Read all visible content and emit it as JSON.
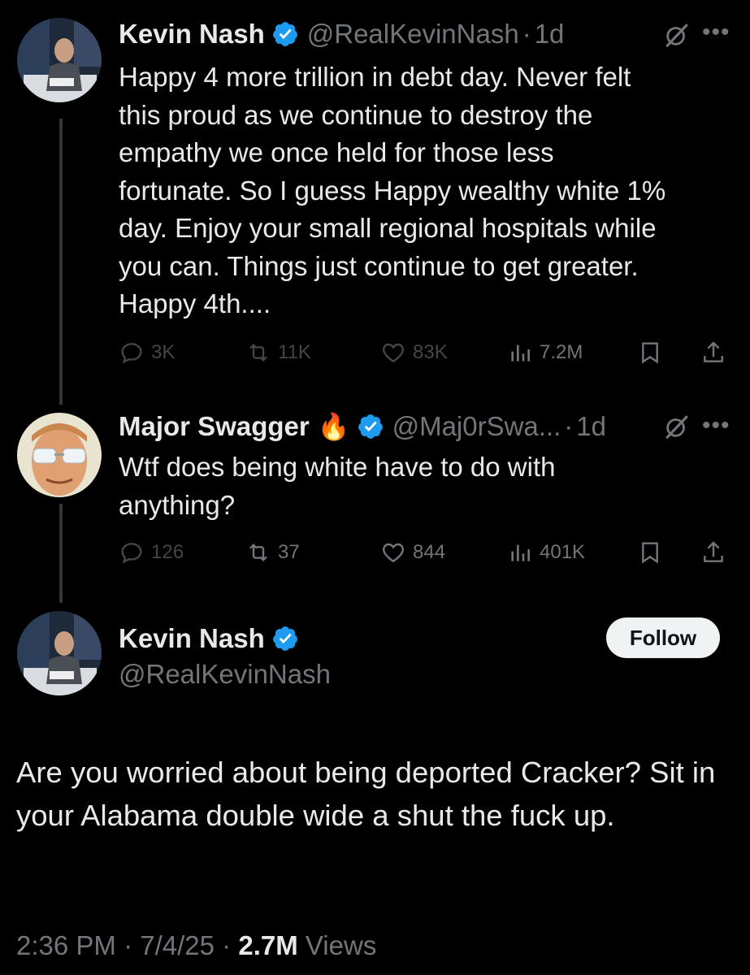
{
  "colors": {
    "background": "#000000",
    "text": "#e7e9ea",
    "muted": "#71767b",
    "verified_blue": "#1d9bf0",
    "follow_bg": "#eff3f4"
  },
  "tweet1": {
    "author_name": "Kevin Nash",
    "handle": "@RealKevinNash",
    "separator": "·",
    "time": "1d",
    "text": "Happy 4 more trillion in debt day. Never felt\nthis proud as we continue to destroy the\nempathy we once held for those less\nfortunate. So I guess Happy wealthy white 1%\nday. Enjoy your small regional hospitals while\nyou can. Things just continue to get greater.\nHappy 4th....",
    "replies": "3K",
    "reposts": "11K",
    "likes": "83K",
    "views": "7.2M"
  },
  "tweet2": {
    "author_name": "Major Swagger",
    "emoji": "🔥",
    "handle": "@Maj0rSwa...",
    "separator": "·",
    "time": "1d",
    "text": "Wtf does being white have to do with\nanything?",
    "replies": "126",
    "reposts": "37",
    "likes": "844",
    "views": "401K"
  },
  "main_tweet": {
    "author_name": "Kevin Nash",
    "handle": "@RealKevinNash",
    "follow_label": "Follow",
    "text": "Are you worried about being deported Cracker? Sit in your Alabama double wide a shut the fuck up.",
    "time": "2:36 PM",
    "sep1": "·",
    "date": "7/4/25",
    "sep2": "·",
    "views_count": "2.7M",
    "views_label": "Views"
  },
  "icons": {
    "verified": "verified-badge-icon",
    "grok": "grok-icon",
    "more": "more-icon",
    "reply": "reply-icon",
    "repost": "repost-icon",
    "like": "like-icon",
    "views": "views-icon",
    "bookmark": "bookmark-icon",
    "share": "share-icon"
  }
}
